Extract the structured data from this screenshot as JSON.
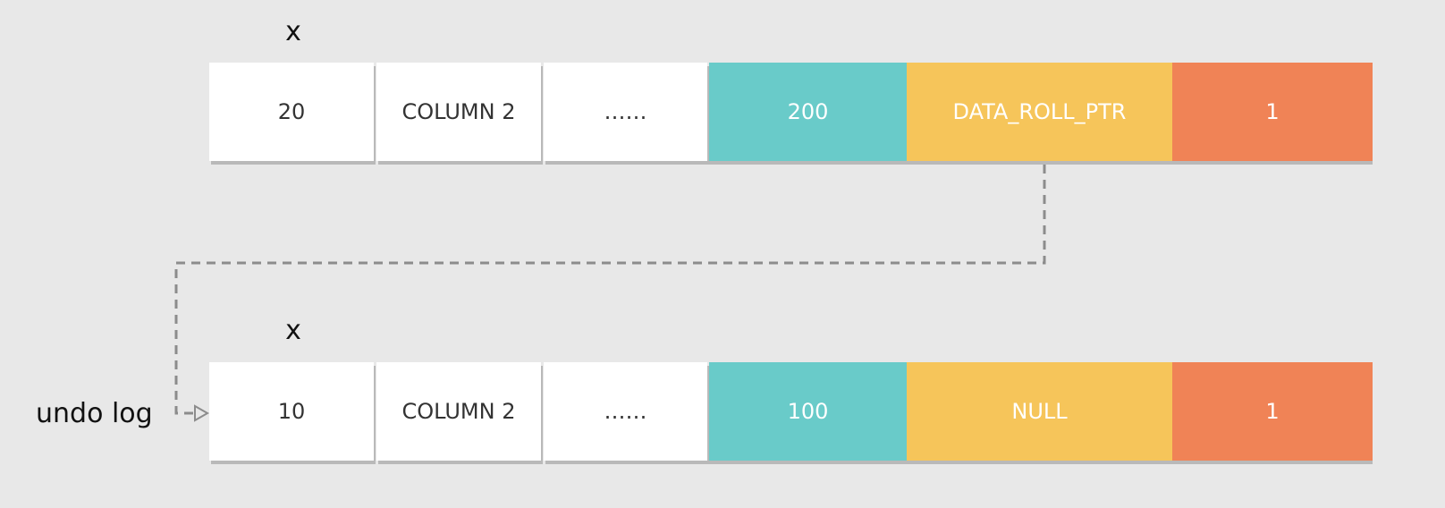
{
  "rows": [
    {
      "label": "x",
      "cells": [
        "20",
        "COLUMN 2",
        "……",
        "200",
        "DATA_ROLL_PTR",
        "1"
      ]
    },
    {
      "label": "x",
      "cells": [
        "10",
        "COLUMN 2",
        "……",
        "100",
        "NULL",
        "1"
      ]
    }
  ],
  "undo_label": "undo log",
  "colors": {
    "background": "#e8e8e8",
    "white_cell": "#ffffff",
    "teal": "#69cbc9",
    "yellow": "#f6c55a",
    "orange": "#f08356",
    "connector": "#8c8c8c"
  }
}
